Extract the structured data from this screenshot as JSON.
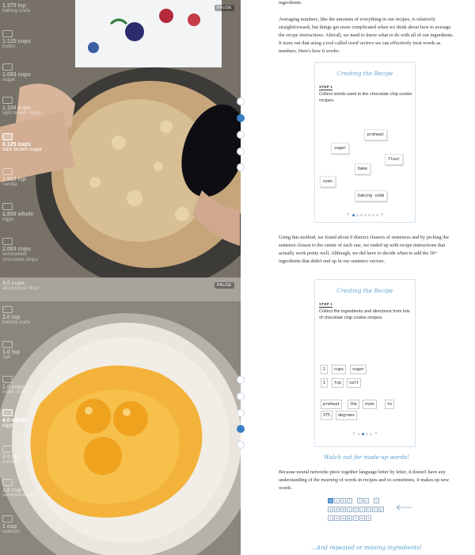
{
  "video_top": {
    "pause_label": "PAUSE",
    "ingredients": [
      {
        "amount": "1.375 tsp",
        "name": "baking soda"
      },
      {
        "amount": "1.125 cups",
        "name": "butter"
      },
      {
        "amount": "1.083 cups",
        "name": "sugar"
      },
      {
        "amount": "1.104 cups",
        "name": "light brown sugar"
      },
      {
        "amount": "0.125 cups",
        "name": "dark brown sugar",
        "active": true
      },
      {
        "amount": "2.583 tsp",
        "name": "vanilla"
      },
      {
        "amount": "2.805 whole",
        "name": "eggs"
      },
      {
        "amount": "2.083 cups",
        "name": "semisweet chocolate chips"
      }
    ]
  },
  "video_bottom": {
    "pause_label": "PAUSE",
    "ingredients": [
      {
        "amount": "4.0 cups",
        "name": "all purpose flour"
      },
      {
        "amount": "2.0 tsp",
        "name": "baking soda"
      },
      {
        "amount": "1.0 tsp",
        "name": "salt"
      },
      {
        "amount": "1.0 cups",
        "name": "white sugar"
      },
      {
        "amount": "4.0 whole",
        "name": "eggs",
        "active": true
      },
      {
        "amount": "2.0 tsp",
        "name": "vanilla"
      },
      {
        "amount": "1.0 cup",
        "name": "semisweet chips"
      },
      {
        "amount": "1 cup",
        "name": "walnuts"
      }
    ]
  },
  "article": {
    "p0": "ingredients.",
    "p1_a": "Averaging numbers, like the amounts of everything in our recipes, is relatively straightforward, but things get more complicated when we think about how to average the recipe ",
    "p1_em1": "instructions",
    "p1_b": ". Afterall, we need to know what to do with all of our ingredients. It turns out that using a tool called ",
    "p1_em2": "word vectors",
    "p1_c": " we can effectively treat words as numbers. Here's how it works:",
    "p2_a": "Using this method, we found about 9 distinct clusters of sentences and by picking the sentence closest to the center of each one, we ended up with recipe instructions that actually work pretty well. Although, we did have to decide when to add the 50+ ingredients that didn't end up in our sentence vectors.",
    "p3_a": "Because neural networks piece together language letter by letter, it doesn't have any understanding of the ",
    "p3_em": "meaning",
    "p3_b": " of words in recipes and so sometimes, it makes up new words.",
    "callout1": "Watch out for made-up words!",
    "callout2": "...And repeated or missing ingredients!"
  },
  "card1": {
    "title": "Creating the Recipe",
    "step": "STEP 1",
    "text": "Collect words used in the chocolate chip cookie recipes.",
    "words": [
      "preheat",
      "sugar",
      "flour",
      "bake",
      "oven",
      "baking soda"
    ]
  },
  "card2": {
    "title": "Creating the Recipe",
    "step": "STEP 1",
    "text": "Collect the ingredients and directions from lots of chocolate chip cookie recipes.",
    "row1": [
      "2",
      "cups",
      "sugar"
    ],
    "row2": [
      "1",
      "tsp",
      "salt"
    ],
    "row3": [
      "preheat",
      "the",
      "oven",
      "to"
    ],
    "row4": [
      "375",
      "degrees"
    ]
  },
  "keys": {
    "row1": [
      "e",
      "s",
      "t",
      "l",
      "",
      "i",
      "n",
      "",
      "c"
    ],
    "row2": [
      "a",
      "d",
      "d",
      "c",
      "h",
      "c",
      "h",
      "i",
      "p"
    ],
    "row3": [
      "c",
      "o",
      "o",
      "k",
      "i",
      "e",
      "s",
      "",
      ""
    ]
  },
  "colors": {
    "accent": "#3a7dc4",
    "callout": "#5aa1d3"
  }
}
